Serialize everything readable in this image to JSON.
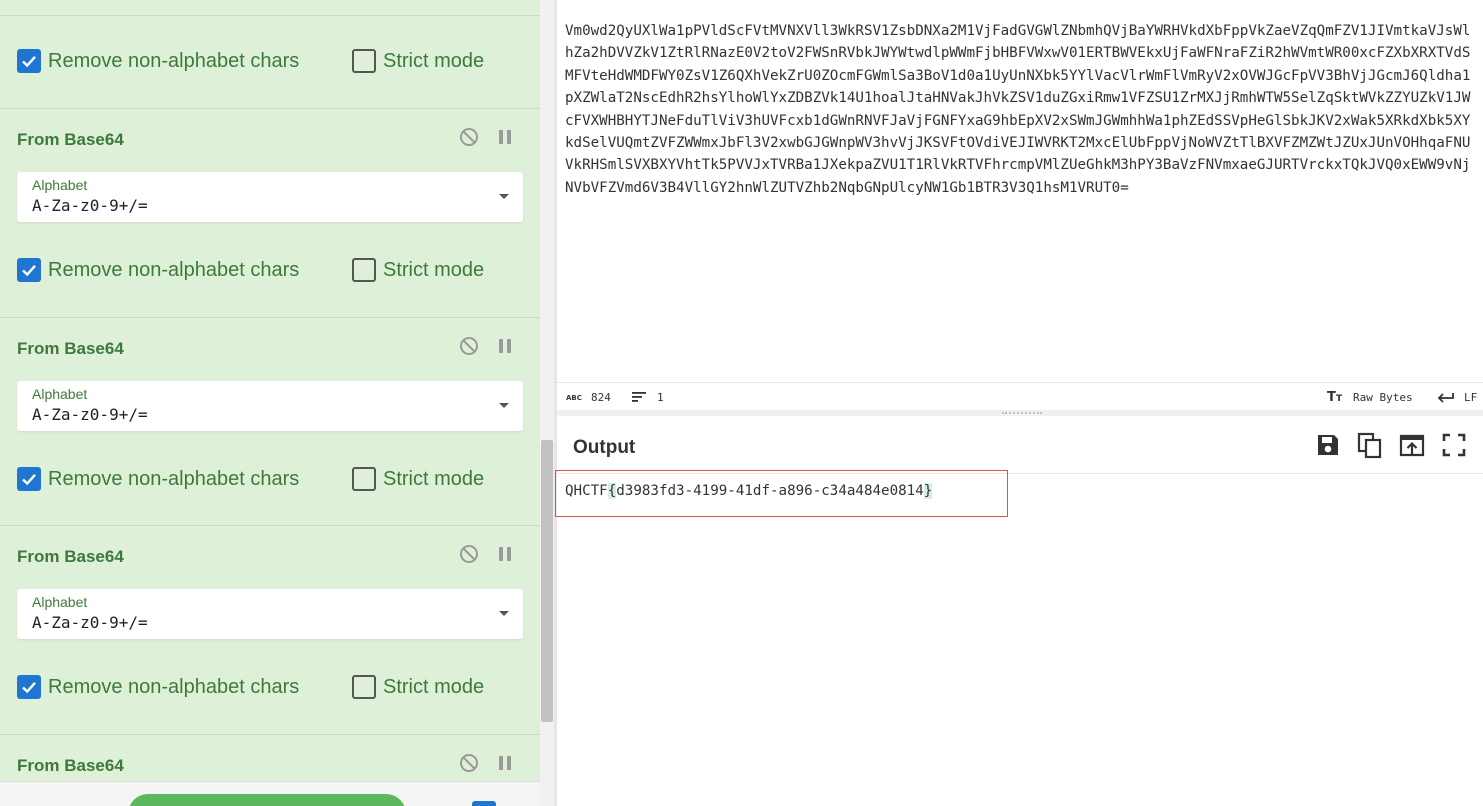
{
  "recipe": {
    "first_row": {
      "remove_label": "Remove non-alphabet chars",
      "strict_label": "Strict mode",
      "remove_checked": true,
      "strict_checked": false
    },
    "operations": [
      {
        "title": "From Base64",
        "alphabet_label": "Alphabet",
        "alphabet_value": "A-Za-z0-9+/=",
        "remove_label": "Remove non-alphabet chars",
        "strict_label": "Strict mode",
        "remove_checked": true,
        "strict_checked": false
      },
      {
        "title": "From Base64",
        "alphabet_label": "Alphabet",
        "alphabet_value": "A-Za-z0-9+/=",
        "remove_label": "Remove non-alphabet chars",
        "strict_label": "Strict mode",
        "remove_checked": true,
        "strict_checked": false
      },
      {
        "title": "From Base64",
        "alphabet_label": "Alphabet",
        "alphabet_value": "A-Za-z0-9+/=",
        "remove_label": "Remove non-alphabet chars",
        "strict_label": "Strict mode",
        "remove_checked": true,
        "strict_checked": false
      },
      {
        "title": "From Base64"
      }
    ],
    "icons": {
      "disable": "disable-icon",
      "pause": "pause-icon"
    }
  },
  "input": {
    "text": "Vm0wd2QyUXlWa1pPVldScFVtMVNXVll3WkRSV1ZsbDNXa2M1VjFadGVGWlZNbmhQVjBaYWRHVkdXbFppVkZaeVZqQmFZV1JIVmtkaVJsWlhZa2hDVVZkV1ZtRlRNazE0V2toV2FWSnRVbkJWYWtwdlpWWmFjbHBFVWxwV01ERTBWVEkxUjFaWFNraFZiR2hWVmtWR00xcFZXbXRXTVdSMFVteHdWMDFWY0ZsV1Z6QXhVekZrU0ZOcmFGWmlSa3BoV1d0a1UyUnNXbk5YYlVacVlrWmFlVmRyV2xOVWJGcFpVV3BhVjJGcmJ6Qldha1pXZWlaT2NscEdhR2hsYlhoWlYxZDBZVk14U1hoalJtaHNVakJhVkZSV1duZGxiRmw1VFZSU1ZrMXJjRmhWTW5SelZqSktWVkZZYUZkV1JWcFVXWHBHYTJNeFduTlViV3hUVFcxb1dGWnRNVFJaVjFGNFYxaG9hbEpXV2xSWmJGWmhhWa1phZEdSSVpHeGlSbkJKV2xWak5XRkdXbk5XYkdSelVUQmtZVFZWWmxJbFl3V2xwbGJGWnpWV3hvVjJKSVFtOVdiVEJIWVRKT2MxcElUbFppVjNoWVZtTlBXVFZMZWtJZUxJUnVOHhqaFNUVkRHSmlSVXBXYVhtTk5PVVJxTVRBa1JXekpaZVU1T1RlVkRTVFhrcmpVMlZUeGhkM3hPY3BaVzFNVmxaeGJURTVrckxTQkJVQ0xEWW9vNjNVbVFZVmd6V3B4VllGY2hnWlZUTVZhb2NqbGNpUlcyNW1Gb1BTR3V3Q1hsM1VRUT0="
  },
  "input_status": {
    "length_icon": "abc-icon",
    "length": "824",
    "lines_icon": "lines-icon",
    "lines": "1",
    "format_icon": "text-format-icon",
    "format": "Raw Bytes",
    "eol_icon": "return-arrow-icon",
    "eol": "LF"
  },
  "output": {
    "title": "Output",
    "prefix": "QHCTF",
    "open_brace": "{",
    "value": "d3983fd3-4199-41df-a896-c34a484e0814",
    "close_brace": "}",
    "buttons": [
      "save-icon",
      "copy-icon",
      "move-to-input-icon",
      "maximise-icon"
    ]
  },
  "colors": {
    "recipe_bg": "#dff0d8",
    "recipe_text": "#3c7a3c",
    "checkbox_blue": "#1f76d2",
    "highlight_border": "#d9534f",
    "bake_green": "#5cb85c"
  }
}
